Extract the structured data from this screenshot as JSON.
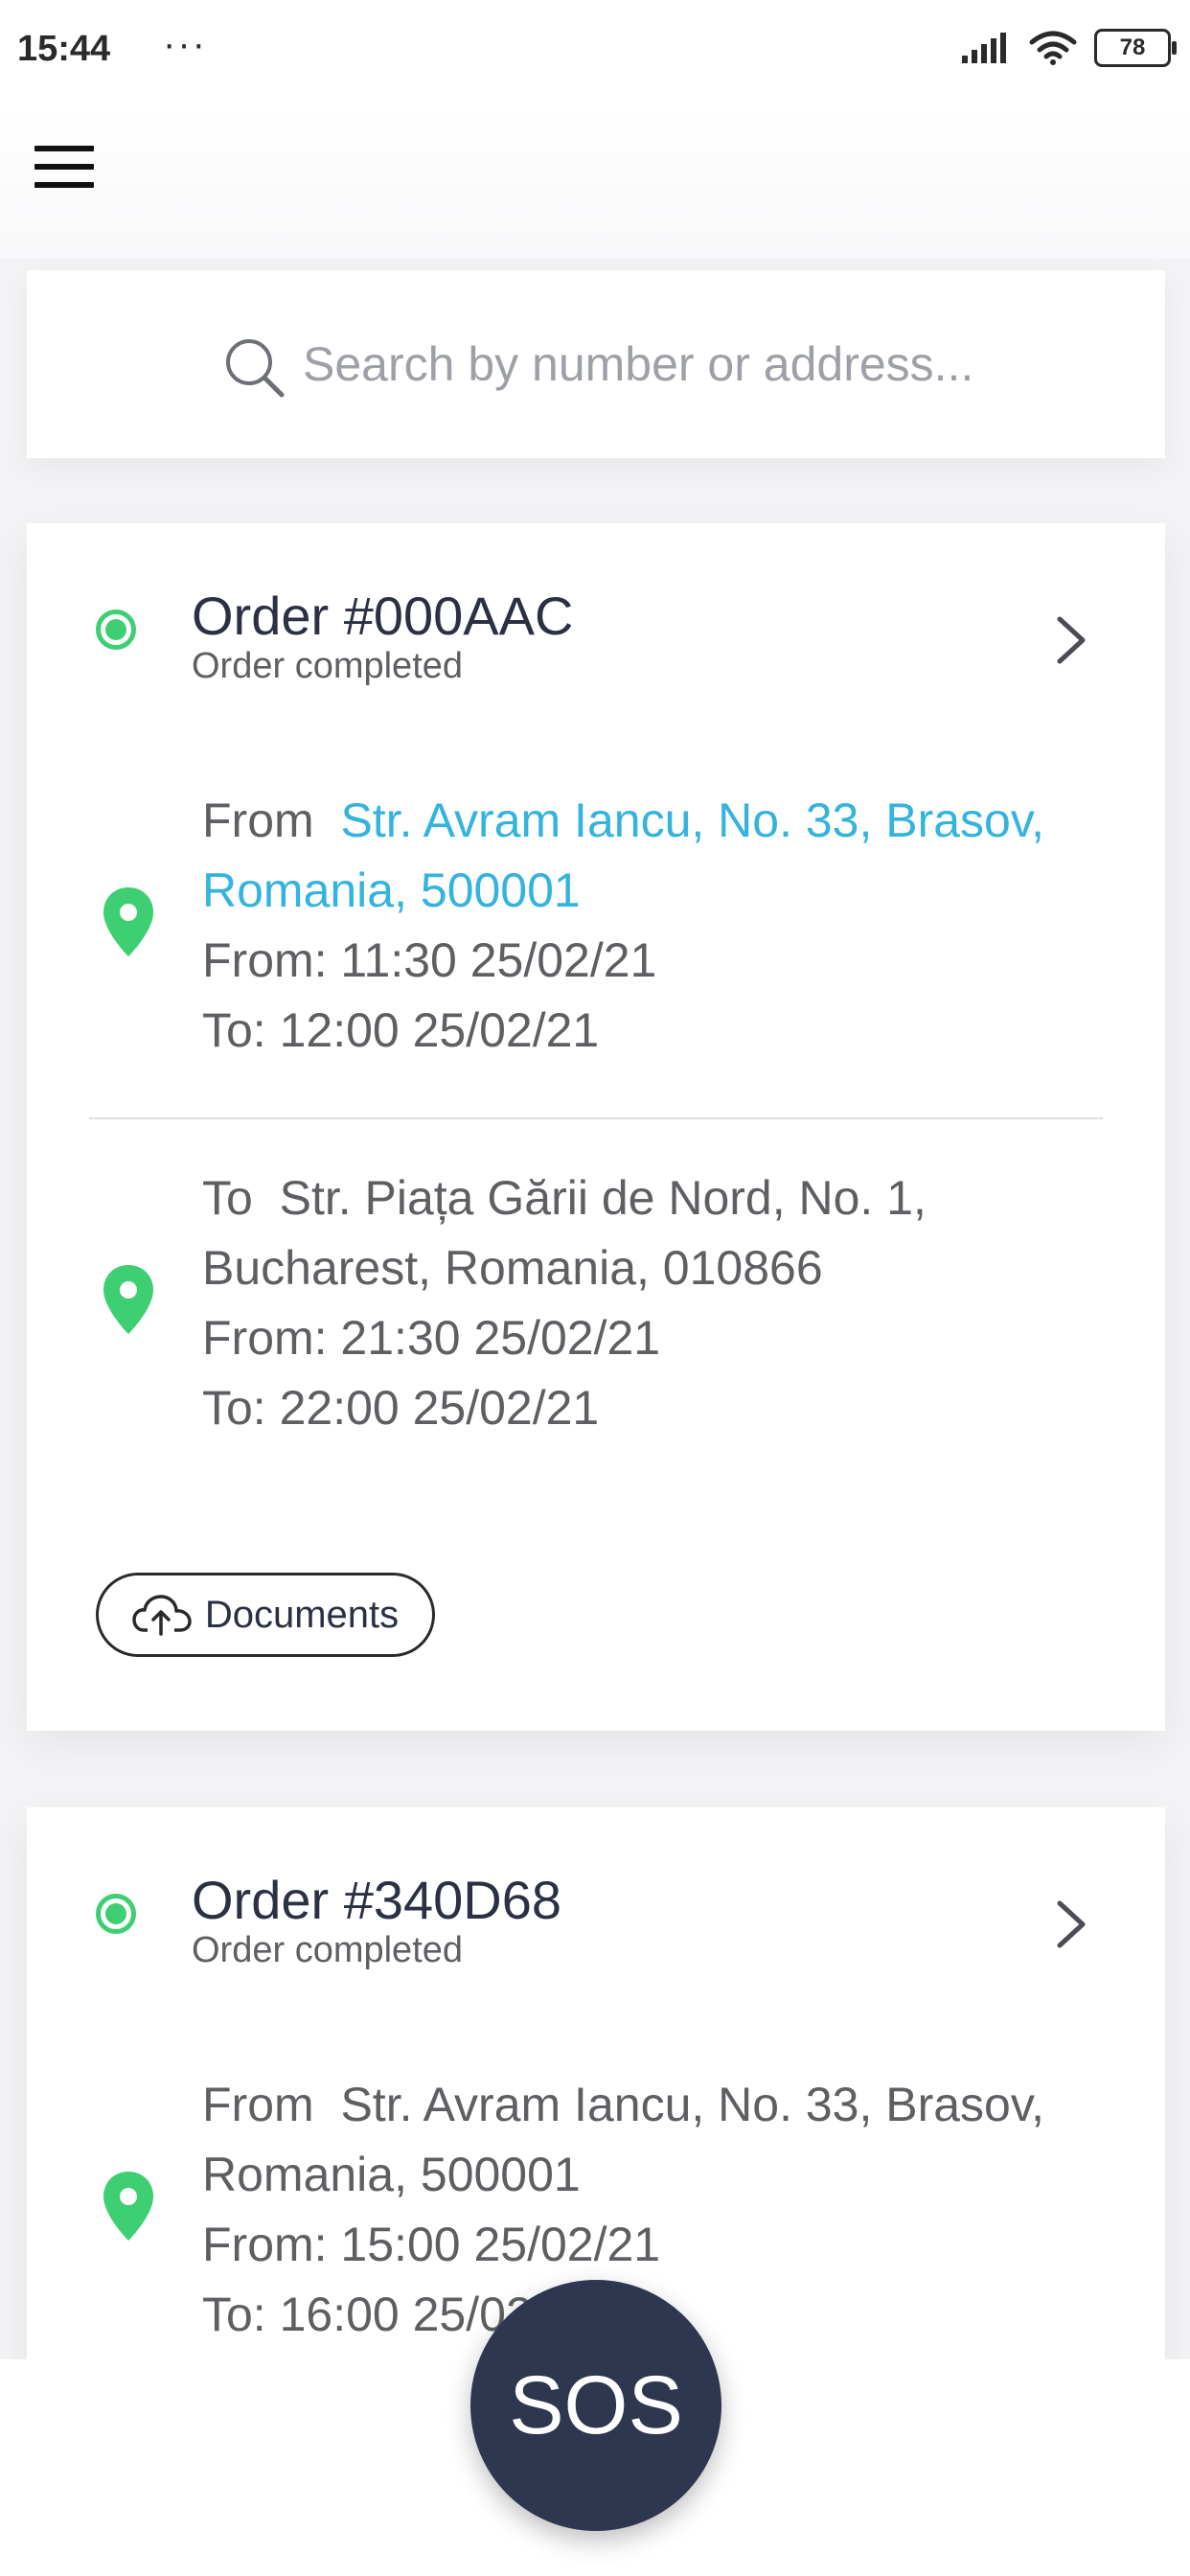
{
  "status_bar": {
    "time": "15:44",
    "dots": "···",
    "battery": "78"
  },
  "search": {
    "placeholder": "Search by number or address..."
  },
  "orders": [
    {
      "title": "Order #000AAC",
      "status": "Order completed",
      "pickup": {
        "prefix": "From",
        "address_line1": "Str. Avram Iancu, No. 33, Brasov,",
        "address_line2": "Romania, 500001",
        "from": "From: 11:30 25/02/21",
        "to": "To: 12:00 25/02/21"
      },
      "dropoff": {
        "prefix": "To",
        "address_line1": "Str. Piața Gării de Nord, No. 1,",
        "address_line2": "Bucharest, Romania, 010866",
        "from": "From: 21:30 25/02/21",
        "to": "To: 22:00 25/02/21"
      },
      "documents_label": "Documents"
    },
    {
      "title": "Order #340D68",
      "status": "Order completed",
      "pickup": {
        "prefix": "From",
        "address_line1": "Str. Avram Iancu, No. 33, Brasov,",
        "address_line2": "Romania, 500001",
        "from": "From: 15:00 25/02/21",
        "to": "To: 16:00 25/02/21"
      }
    }
  ],
  "sos_label": "SOS",
  "colors": {
    "accent_green": "#3fcf73",
    "link_blue": "#34b3df",
    "sos_navy": "#2e3650"
  }
}
